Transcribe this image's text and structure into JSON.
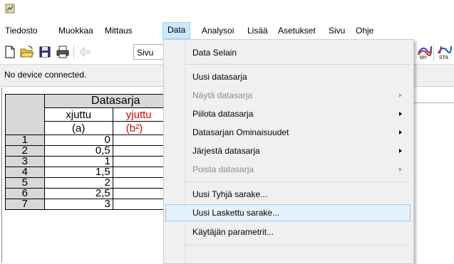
{
  "menu": {
    "items": [
      {
        "key": "tiedosto",
        "label": "Tiedosto"
      },
      {
        "key": "muokkaa",
        "label": "Muokkaa"
      },
      {
        "key": "mittaus",
        "label": "Mittaus"
      },
      {
        "key": "data",
        "label": "Data"
      },
      {
        "key": "analysoi",
        "label": "Analysoi"
      },
      {
        "key": "lisaa",
        "label": "Lisää"
      },
      {
        "key": "asetukset",
        "label": "Asetukset"
      },
      {
        "key": "sivu",
        "label": "Sivu"
      },
      {
        "key": "ohje",
        "label": "Ohje"
      }
    ],
    "open": "Data"
  },
  "toolbar": {
    "page_selector_value": "Sivu",
    "right_icon_labels": [
      "M=",
      "STA"
    ]
  },
  "status": {
    "text": "No device connected."
  },
  "table": {
    "group_header": "Datasarja",
    "columns": [
      {
        "name": "xjuttu",
        "unit": "(a)",
        "color": "#000000"
      },
      {
        "name": "yjuttu",
        "unit": "(b²)",
        "color": "#e00000"
      }
    ],
    "rows": [
      {
        "n": "1",
        "x": "0"
      },
      {
        "n": "2",
        "x": "0,5"
      },
      {
        "n": "3",
        "x": "1"
      },
      {
        "n": "4",
        "x": "1,5"
      },
      {
        "n": "5",
        "x": "2"
      },
      {
        "n": "6",
        "x": "2,5"
      },
      {
        "n": "7",
        "x": "3"
      }
    ]
  },
  "dropdown": {
    "items": [
      {
        "label": "Data Selain",
        "enabled": true,
        "submenu": false
      },
      {
        "label": "Uusi datasarja",
        "enabled": true,
        "submenu": false
      },
      {
        "label": "Näytä datasarja",
        "enabled": false,
        "submenu": true
      },
      {
        "label": "Piilota datasarja",
        "enabled": true,
        "submenu": true
      },
      {
        "label": "Datasarjan Ominaisuudet",
        "enabled": true,
        "submenu": true
      },
      {
        "label": "Järjestä datasarja",
        "enabled": true,
        "submenu": true
      },
      {
        "label": "Poista datasarja",
        "enabled": false,
        "submenu": true
      },
      {
        "label": "Uusi Tyhjä sarake...",
        "enabled": true,
        "submenu": false
      },
      {
        "label": "Uusi Laskettu sarake...",
        "enabled": true,
        "submenu": false,
        "highlighted": true
      },
      {
        "label": "Käytäjän parametrit...",
        "enabled": true,
        "submenu": false
      }
    ]
  },
  "colors": {
    "menu_open_bg": "#cce8ff",
    "highlight_bg": "#e5f1fb",
    "highlight_border": "#99c9ef",
    "disabled_text": "#8c8c8c",
    "y_column_text": "#e00000"
  }
}
